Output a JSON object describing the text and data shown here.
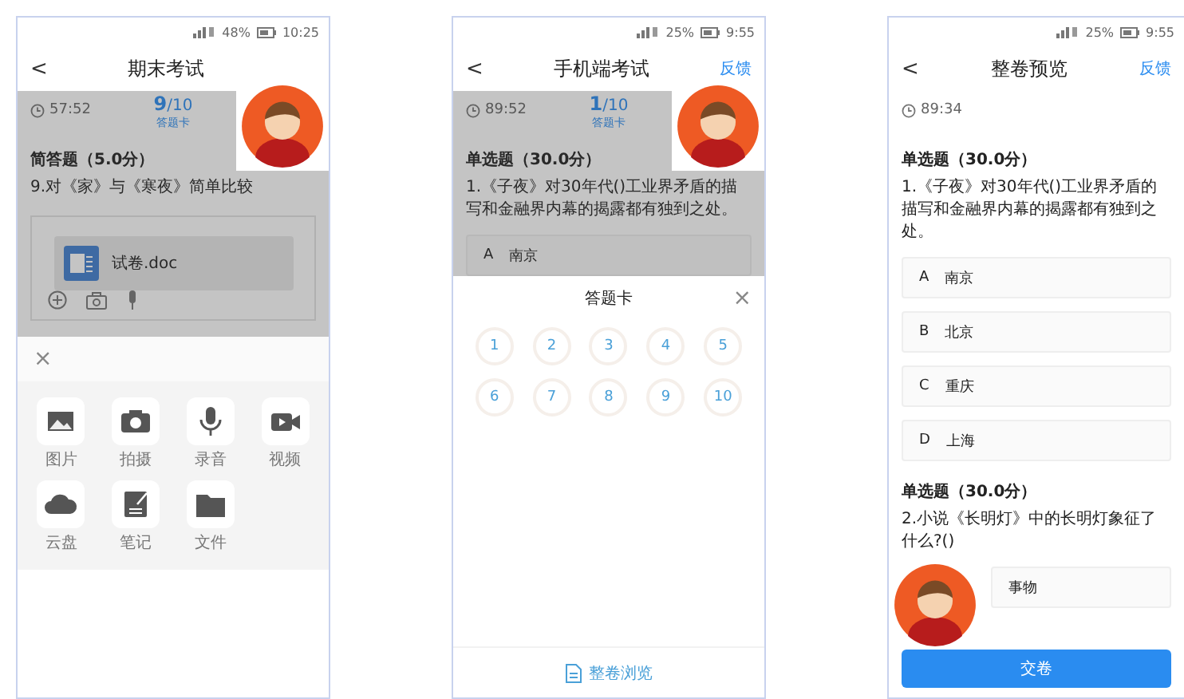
{
  "screens": [
    {
      "kind": "answer",
      "status": {
        "battery": "48%",
        "time": "10:25"
      },
      "header": {
        "back": "<",
        "title": "期末考试"
      },
      "timer": "57:52",
      "progress": {
        "current": "9",
        "total": "/10"
      },
      "card_link": "答题卡",
      "dimmed": true,
      "avatar": true,
      "questions": [
        {
          "type": "简答题（5.0分）",
          "text": "9.对《家》与《寒夜》简单比较",
          "attachment": "试卷.doc"
        }
      ],
      "sheet": {
        "kind": "attach",
        "close": "×",
        "items": [
          {
            "label": "图片"
          },
          {
            "label": "拍摄"
          },
          {
            "label": "录音"
          },
          {
            "label": "视频"
          },
          {
            "label": "云盘"
          },
          {
            "label": "笔记"
          },
          {
            "label": "文件"
          }
        ]
      }
    },
    {
      "kind": "card",
      "status": {
        "battery": "25%",
        "time": "9:55"
      },
      "header": {
        "back": "<",
        "title": "手机端考试",
        "action": "反馈"
      },
      "timer": "89:52",
      "progress": {
        "current": "1",
        "total": "/10"
      },
      "card_link": "答题卡",
      "dimmed": true,
      "avatar": true,
      "questions": [
        {
          "type": "单选题（30.0分）",
          "text": "1.《子夜》对30年代()工业界矛盾的描写和金融界内幕的揭露都有独到之处。",
          "options": [
            {
              "letter": "A",
              "text": "南京"
            }
          ]
        }
      ],
      "sheet": {
        "kind": "answer-card",
        "title": "答题卡",
        "close": "×",
        "numbers": [
          "1",
          "2",
          "3",
          "4",
          "5",
          "6",
          "7",
          "8",
          "9",
          "10"
        ],
        "footer": "整卷浏览"
      }
    },
    {
      "kind": "preview",
      "status": {
        "battery": "25%",
        "time": "9:55"
      },
      "header": {
        "back": "<",
        "title": "整卷预览",
        "action": "反馈"
      },
      "timer": "89:34",
      "avatar": true,
      "questions": [
        {
          "type": "单选题（30.0分）",
          "text": "1.《子夜》对30年代()工业界矛盾的描写和金融界内幕的揭露都有独到之处。",
          "options": [
            {
              "letter": "A",
              "text": "南京"
            },
            {
              "letter": "B",
              "text": "北京"
            },
            {
              "letter": "C",
              "text": "重庆"
            },
            {
              "letter": "D",
              "text": "上海"
            }
          ]
        },
        {
          "type": "单选题（30.0分）",
          "text": "2.小说《长明灯》中的长明灯象征了什么?()",
          "options": [
            {
              "text": "事物"
            }
          ]
        }
      ],
      "submit": "交卷"
    }
  ]
}
